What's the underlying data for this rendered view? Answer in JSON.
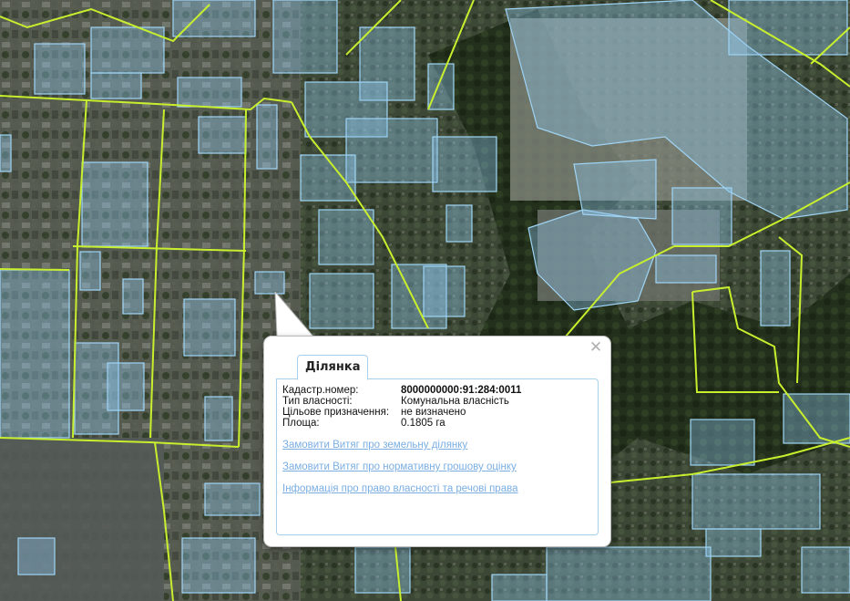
{
  "popup": {
    "tab_label": "Ділянка",
    "close_glyph": "✕",
    "fields": [
      {
        "label": "Кадастр.номер:",
        "value": "8000000000:91:284:0011"
      },
      {
        "label": "Тип власності:",
        "value": "Комунальна власність"
      },
      {
        "label": "Цільове призначення:",
        "value": "не визначено"
      },
      {
        "label": "Площа:",
        "value": "0.1805 га"
      }
    ],
    "links": [
      "Замовити Витяг про земельну ділянку",
      "Замовити Витяг про нормативну грошову оцінку",
      "Інформація про право власності та речові права"
    ]
  },
  "colors": {
    "parcel_fill": "#8ec7ee",
    "parcel_stroke": "#9fd4f5",
    "boundary_line": "#c8ef2e",
    "link": "#7aaee3",
    "panel_border": "#a9d0ea"
  }
}
